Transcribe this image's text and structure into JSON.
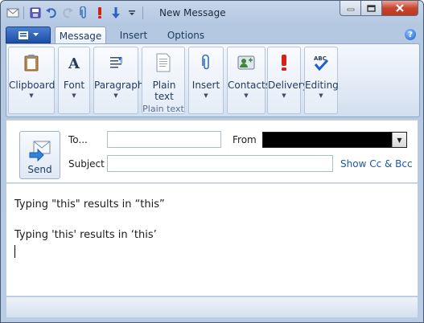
{
  "window": {
    "title": "New Message"
  },
  "tabs": [
    {
      "label": "Message",
      "active": true
    },
    {
      "label": "Insert",
      "active": false
    },
    {
      "label": "Options",
      "active": false
    }
  ],
  "ribbon": {
    "groups": [
      {
        "label": "Clipboard",
        "icon": "clipboard-icon"
      },
      {
        "label": "Font",
        "icon": "font-icon"
      },
      {
        "label": "Paragraph",
        "icon": "paragraph-icon"
      },
      {
        "label": "Plain text",
        "icon": "plain-text-icon",
        "footer": "Plain text"
      },
      {
        "label": "Insert",
        "icon": "paperclip-icon"
      },
      {
        "label": "Contacts",
        "icon": "contacts-icon"
      },
      {
        "label": "Delivery",
        "icon": "priority-icon"
      },
      {
        "label": "Editing",
        "icon": "spellcheck-icon"
      }
    ]
  },
  "header": {
    "send_label": "Send",
    "to_label": "To...",
    "to_value": "",
    "from_label": "From",
    "subject_label": "Subject",
    "subject_value": "",
    "show_cc_bcc": "Show Cc & Bcc"
  },
  "body": {
    "lines": [
      "Typing \"this\" results in “this”",
      "Typing 'this' results in ‘this’"
    ]
  },
  "colors": {
    "accent": "#1d4ea5",
    "link": "#1c56b0",
    "close": "#c8452f"
  }
}
